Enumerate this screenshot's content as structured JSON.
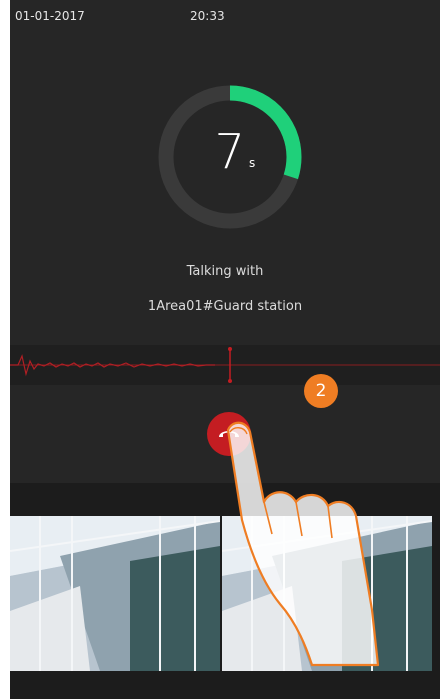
{
  "status_bar": {
    "date": "01-01-2017",
    "time": "20:33"
  },
  "call_timer": {
    "value": "7",
    "unit": "s",
    "progress": 0.3
  },
  "call_status": {
    "label": "Talking with",
    "target": "1Area01#Guard station"
  },
  "hangup_button": {
    "icon": "phone-hangup-icon",
    "color": "#c41d22"
  },
  "tutorial": {
    "step": "2",
    "color": "#ef7d23"
  },
  "cameras": [
    {
      "name": "camera-feed-1"
    },
    {
      "name": "camera-feed-2"
    }
  ],
  "colors": {
    "background": "#262626",
    "accent_green": "#1fd07a",
    "waveform_red": "#b01f24"
  }
}
